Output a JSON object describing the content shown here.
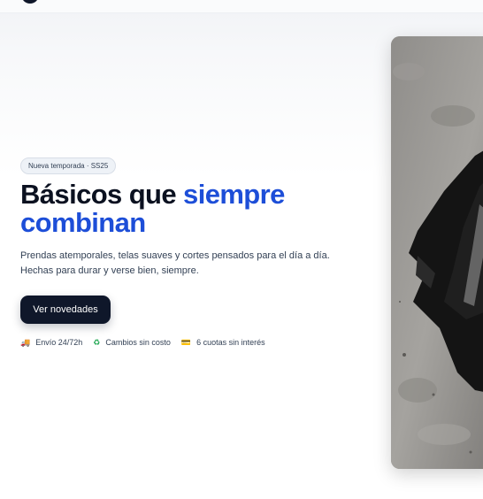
{
  "header": {
    "logo_icon": "brand-logo"
  },
  "hero": {
    "badge": "Nueva temporada · SS25",
    "headline_part1": "Básicos que ",
    "headline_accent": "siempre combinan",
    "description_line1": "Prendas atemporales, telas suaves y cortes pensados para el día a día.",
    "description_line2": "Hechas para durar y verse bien, siempre.",
    "cta_label": "Ver novedades",
    "accent_color": "#1d4ed8",
    "cta_color": "#0f172a"
  },
  "perks": [
    {
      "icon": "truck-icon",
      "glyph": "🚚",
      "label": "Envío 24/72h"
    },
    {
      "icon": "recycle-icon",
      "glyph": "♻",
      "label": "Cambios sin costo"
    },
    {
      "icon": "credit-card-icon",
      "glyph": "💳",
      "label": "6 cuotas sin interés"
    }
  ],
  "image": {
    "subject": "black-shirt-on-concrete-photo"
  }
}
